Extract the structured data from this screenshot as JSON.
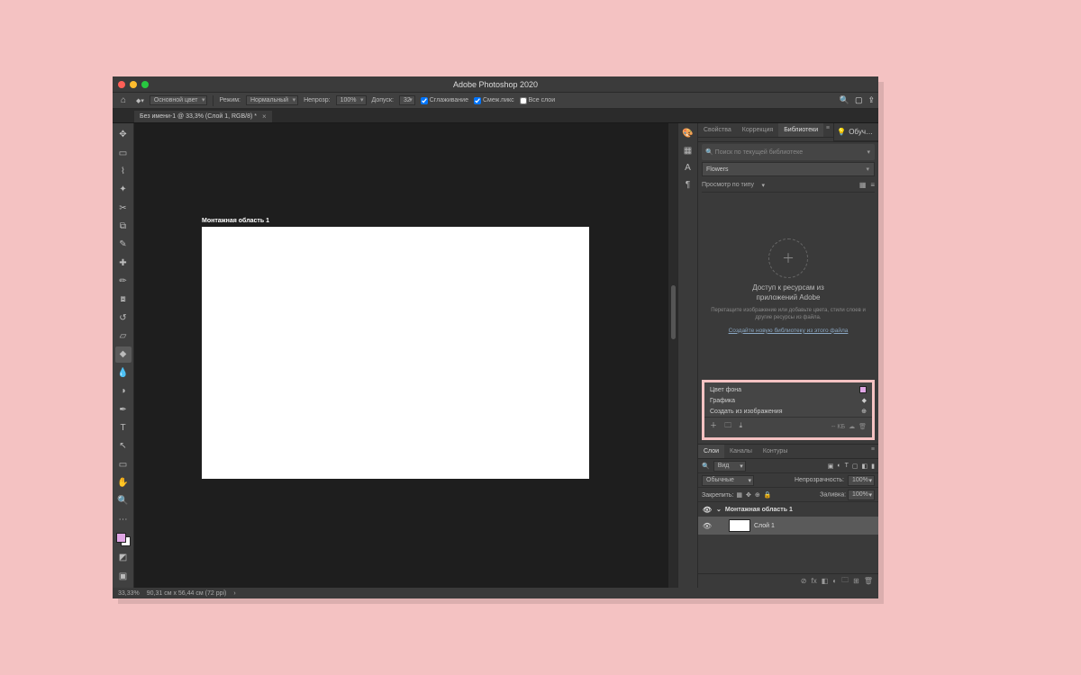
{
  "app": {
    "title": "Adobe Photoshop 2020"
  },
  "optbar": {
    "foreground": "Основной цвет",
    "mode_lbl": "Режим:",
    "mode_val": "Нормальный",
    "opacity_lbl": "Непрозр:",
    "opacity_val": "100%",
    "tolerance_lbl": "Допуск:",
    "tolerance_val": "32",
    "antialias": "Сглаживание",
    "contig": "Смеж.пикс",
    "alllayers": "Все слои"
  },
  "doc": {
    "tab": "Без имени-1 @ 33,3% (Слой 1, RGB/8) *",
    "artboard": "Монтажная область 1"
  },
  "status": {
    "zoom": "33,33%",
    "docinfo": "90,31 см x 56,44 см (72 ppi)"
  },
  "panels": {
    "props": "Свойства",
    "adjust": "Коррекция",
    "libs": "Библиотеки",
    "learn": "Обуч…"
  },
  "lib": {
    "search": "Поиск по текущей библиотеке",
    "libname": "Flowers",
    "viewby": "Просмотр по типу",
    "h1": "Доступ к ресурсам из",
    "h2": "приложений Adobe",
    "p": "Перетащите изображение или добавьте цвета, стили слоев и другие ресурсы из файла.",
    "link": "Создайте новую библиотеку из этого файла"
  },
  "highlight": {
    "bg": "Цвет фона",
    "gfx": "Графика",
    "create": "Создать из изображения",
    "size": "-- КБ"
  },
  "layers": {
    "tab_layers": "Слои",
    "tab_channels": "Каналы",
    "tab_paths": "Контуры",
    "filter": "Вид",
    "blend": "Обычные",
    "opacity_lbl": "Непрозрачность:",
    "opacity_val": "100%",
    "lock_lbl": "Закрепить:",
    "fill_lbl": "Заливка:",
    "fill_val": "100%",
    "artboard": "Монтажная область 1",
    "layer1": "Слой 1"
  }
}
